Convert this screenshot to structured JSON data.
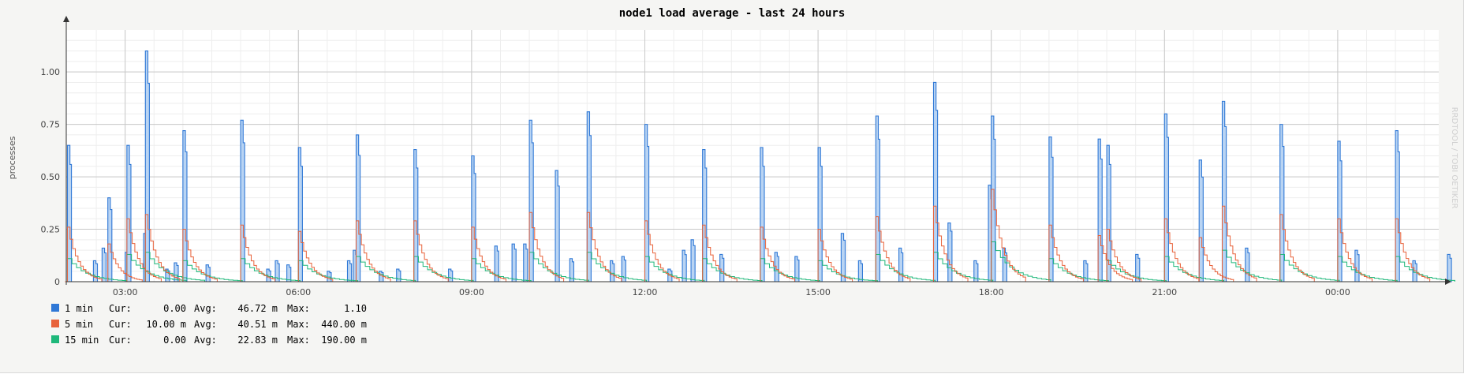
{
  "chart_data": {
    "type": "area",
    "title": "node1 load average - last 24 hours",
    "ylabel": "processes",
    "xlabel": "",
    "watermark": "RRDTOOL / TOBI OETIKER",
    "ylim": [
      0,
      1.2
    ],
    "yticks": [
      0,
      0.25,
      0.5,
      0.75,
      1.0
    ],
    "ytick_labels": [
      "0",
      "0.25",
      "0.50",
      "0.75",
      "1.00"
    ],
    "xlim": [
      "2:00",
      "1:30"
    ],
    "xticks": [
      3,
      6,
      9,
      12,
      15,
      18,
      21,
      24
    ],
    "xtick_labels": [
      "03:00",
      "06:00",
      "09:00",
      "12:00",
      "15:00",
      "18:00",
      "21:00",
      "00:00"
    ],
    "grid": true,
    "legend_position": "bottom-left",
    "series": [
      {
        "name": "1 min",
        "color": "#2f78d6",
        "fill": "#b9d4f3",
        "stats": {
          "cur": "0.00",
          "avg": "46.72 m",
          "max": "1.10"
        },
        "peaks": [
          {
            "t": 2.0,
            "v": 0.65
          },
          {
            "t": 2.45,
            "v": 0.1
          },
          {
            "t": 2.6,
            "v": 0.16
          },
          {
            "t": 2.7,
            "v": 0.4
          },
          {
            "t": 3.0,
            "v": 0.14
          },
          {
            "t": 3.03,
            "v": 0.65
          },
          {
            "t": 3.32,
            "v": 0.23
          },
          {
            "t": 3.35,
            "v": 1.1
          },
          {
            "t": 3.7,
            "v": 0.06
          },
          {
            "t": 3.85,
            "v": 0.09
          },
          {
            "t": 4.0,
            "v": 0.72
          },
          {
            "t": 4.4,
            "v": 0.08
          },
          {
            "t": 5.0,
            "v": 0.77
          },
          {
            "t": 5.45,
            "v": 0.06
          },
          {
            "t": 5.6,
            "v": 0.1
          },
          {
            "t": 5.8,
            "v": 0.08
          },
          {
            "t": 6.0,
            "v": 0.64
          },
          {
            "t": 6.5,
            "v": 0.05
          },
          {
            "t": 6.85,
            "v": 0.1
          },
          {
            "t": 6.95,
            "v": 0.15
          },
          {
            "t": 7.0,
            "v": 0.7
          },
          {
            "t": 7.4,
            "v": 0.05
          },
          {
            "t": 7.7,
            "v": 0.06
          },
          {
            "t": 8.0,
            "v": 0.63
          },
          {
            "t": 8.6,
            "v": 0.06
          },
          {
            "t": 9.0,
            "v": 0.6
          },
          {
            "t": 9.4,
            "v": 0.17
          },
          {
            "t": 9.7,
            "v": 0.18
          },
          {
            "t": 9.9,
            "v": 0.18
          },
          {
            "t": 10.0,
            "v": 0.77
          },
          {
            "t": 10.45,
            "v": 0.53
          },
          {
            "t": 10.7,
            "v": 0.11
          },
          {
            "t": 11.0,
            "v": 0.81
          },
          {
            "t": 11.4,
            "v": 0.1
          },
          {
            "t": 11.6,
            "v": 0.12
          },
          {
            "t": 12.0,
            "v": 0.75
          },
          {
            "t": 12.4,
            "v": 0.06
          },
          {
            "t": 12.65,
            "v": 0.15
          },
          {
            "t": 12.8,
            "v": 0.2
          },
          {
            "t": 13.0,
            "v": 0.63
          },
          {
            "t": 13.3,
            "v": 0.13
          },
          {
            "t": 14.0,
            "v": 0.64
          },
          {
            "t": 14.25,
            "v": 0.14
          },
          {
            "t": 14.6,
            "v": 0.12
          },
          {
            "t": 15.0,
            "v": 0.64
          },
          {
            "t": 15.4,
            "v": 0.23
          },
          {
            "t": 15.7,
            "v": 0.1
          },
          {
            "t": 16.0,
            "v": 0.79
          },
          {
            "t": 16.4,
            "v": 0.16
          },
          {
            "t": 17.0,
            "v": 0.95
          },
          {
            "t": 17.25,
            "v": 0.28
          },
          {
            "t": 17.7,
            "v": 0.1
          },
          {
            "t": 17.95,
            "v": 0.46
          },
          {
            "t": 18.0,
            "v": 0.79
          },
          {
            "t": 18.2,
            "v": 0.16
          },
          {
            "t": 19.0,
            "v": 0.69
          },
          {
            "t": 19.6,
            "v": 0.1
          },
          {
            "t": 19.85,
            "v": 0.68
          },
          {
            "t": 20.0,
            "v": 0.65
          },
          {
            "t": 20.5,
            "v": 0.13
          },
          {
            "t": 21.0,
            "v": 0.8
          },
          {
            "t": 21.6,
            "v": 0.58
          },
          {
            "t": 22.0,
            "v": 0.86
          },
          {
            "t": 22.4,
            "v": 0.16
          },
          {
            "t": 23.0,
            "v": 0.75
          },
          {
            "t": 24.0,
            "v": 0.67
          },
          {
            "t": 24.3,
            "v": 0.15
          },
          {
            "t": 25.0,
            "v": 0.72
          },
          {
            "t": 25.3,
            "v": 0.1
          },
          {
            "t": 25.9,
            "v": 0.13
          }
        ]
      },
      {
        "name": "5 min",
        "color": "#e8623a",
        "stats": {
          "cur": "10.00 m",
          "avg": "40.51 m",
          "max": "440.00 m"
        },
        "peaks": [
          {
            "t": 2.0,
            "v": 0.26
          },
          {
            "t": 2.7,
            "v": 0.18
          },
          {
            "t": 3.03,
            "v": 0.3
          },
          {
            "t": 3.35,
            "v": 0.32
          },
          {
            "t": 4.0,
            "v": 0.25
          },
          {
            "t": 5.0,
            "v": 0.27
          },
          {
            "t": 6.0,
            "v": 0.24
          },
          {
            "t": 7.0,
            "v": 0.29
          },
          {
            "t": 8.0,
            "v": 0.29
          },
          {
            "t": 9.0,
            "v": 0.26
          },
          {
            "t": 10.0,
            "v": 0.33
          },
          {
            "t": 11.0,
            "v": 0.33
          },
          {
            "t": 12.0,
            "v": 0.29
          },
          {
            "t": 13.0,
            "v": 0.27
          },
          {
            "t": 14.0,
            "v": 0.26
          },
          {
            "t": 15.0,
            "v": 0.25
          },
          {
            "t": 16.0,
            "v": 0.31
          },
          {
            "t": 17.0,
            "v": 0.36
          },
          {
            "t": 18.0,
            "v": 0.44
          },
          {
            "t": 19.0,
            "v": 0.27
          },
          {
            "t": 19.85,
            "v": 0.22
          },
          {
            "t": 20.0,
            "v": 0.25
          },
          {
            "t": 21.0,
            "v": 0.3
          },
          {
            "t": 21.6,
            "v": 0.21
          },
          {
            "t": 22.0,
            "v": 0.36
          },
          {
            "t": 23.0,
            "v": 0.32
          },
          {
            "t": 24.0,
            "v": 0.3
          },
          {
            "t": 25.0,
            "v": 0.3
          }
        ]
      },
      {
        "name": "15 min",
        "color": "#1fb87a",
        "stats": {
          "cur": "0.00",
          "avg": "22.83 m",
          "max": "190.00 m"
        },
        "peaks": [
          {
            "t": 2.0,
            "v": 0.11
          },
          {
            "t": 3.03,
            "v": 0.13
          },
          {
            "t": 3.35,
            "v": 0.14
          },
          {
            "t": 4.0,
            "v": 0.1
          },
          {
            "t": 5.0,
            "v": 0.11
          },
          {
            "t": 6.0,
            "v": 0.1
          },
          {
            "t": 7.0,
            "v": 0.12
          },
          {
            "t": 8.0,
            "v": 0.12
          },
          {
            "t": 9.0,
            "v": 0.11
          },
          {
            "t": 10.0,
            "v": 0.14
          },
          {
            "t": 11.0,
            "v": 0.14
          },
          {
            "t": 12.0,
            "v": 0.12
          },
          {
            "t": 13.0,
            "v": 0.11
          },
          {
            "t": 14.0,
            "v": 0.11
          },
          {
            "t": 15.0,
            "v": 0.1
          },
          {
            "t": 16.0,
            "v": 0.13
          },
          {
            "t": 17.0,
            "v": 0.14
          },
          {
            "t": 18.0,
            "v": 0.19
          },
          {
            "t": 19.0,
            "v": 0.11
          },
          {
            "t": 20.0,
            "v": 0.1
          },
          {
            "t": 21.0,
            "v": 0.12
          },
          {
            "t": 22.0,
            "v": 0.15
          },
          {
            "t": 23.0,
            "v": 0.13
          },
          {
            "t": 24.0,
            "v": 0.12
          },
          {
            "t": 25.0,
            "v": 0.12
          }
        ]
      }
    ]
  }
}
